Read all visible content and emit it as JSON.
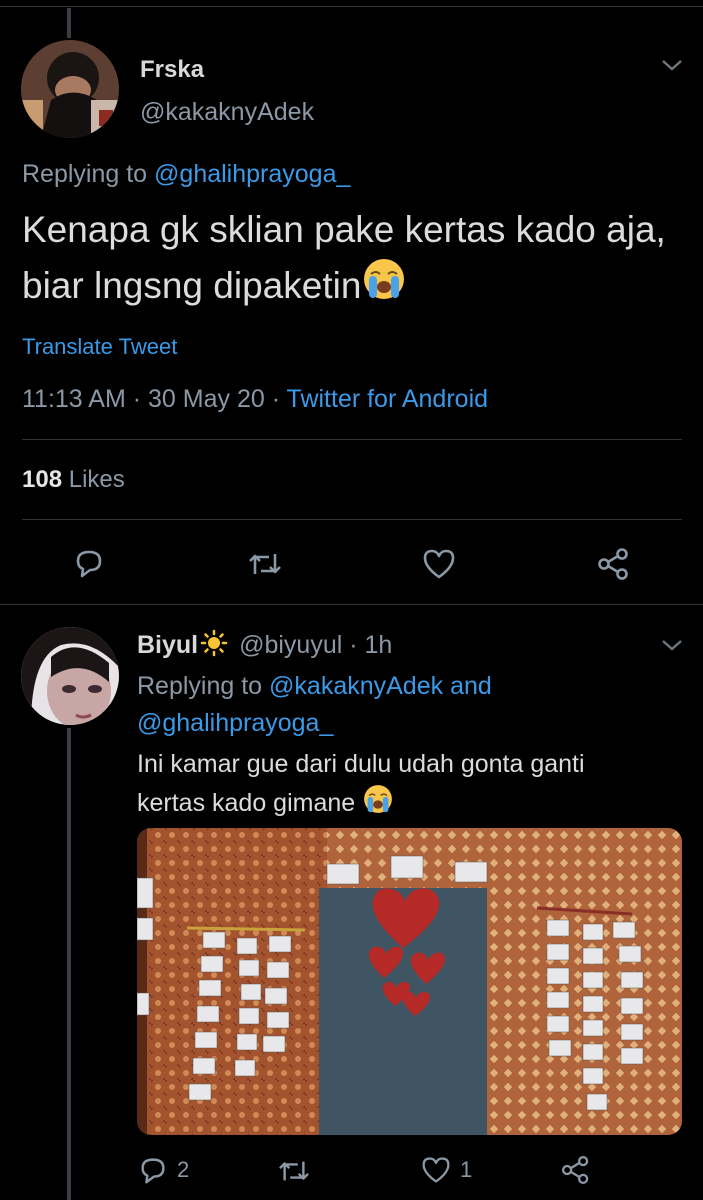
{
  "tweet": {
    "display_name": "Frska",
    "handle": "@kakaknyAdek",
    "replying_prefix": "Replying to",
    "replying_to": "@ghalihprayoga_",
    "text": "Kenapa gk sklian pake kertas kado aja, biar lngsng dipaketin",
    "emoji": "crying-face",
    "translate": "Translate Tweet",
    "time": "11:13 AM",
    "date": "30 May 20",
    "sep": "·",
    "client": "Twitter for Android",
    "likes_count": "108",
    "likes_label": "Likes"
  },
  "reply": {
    "display_name": "Biyul",
    "handle": "@biyuyul",
    "time": "1h",
    "sep": "·",
    "replying_prefix": "Replying to",
    "mention1": "@kakaknyAdek",
    "and": "and",
    "mention2": "@ghalihprayoga_",
    "text_line1": "Ini kamar gue dari dulu udah gonta ganti",
    "text_line2": "kertas kado gimane",
    "reply_count": "2",
    "like_count": "1"
  },
  "colors": {
    "background": "#000000",
    "link": "#3b9ae8",
    "muted": "#8b98a5",
    "divider": "#2f3336"
  }
}
